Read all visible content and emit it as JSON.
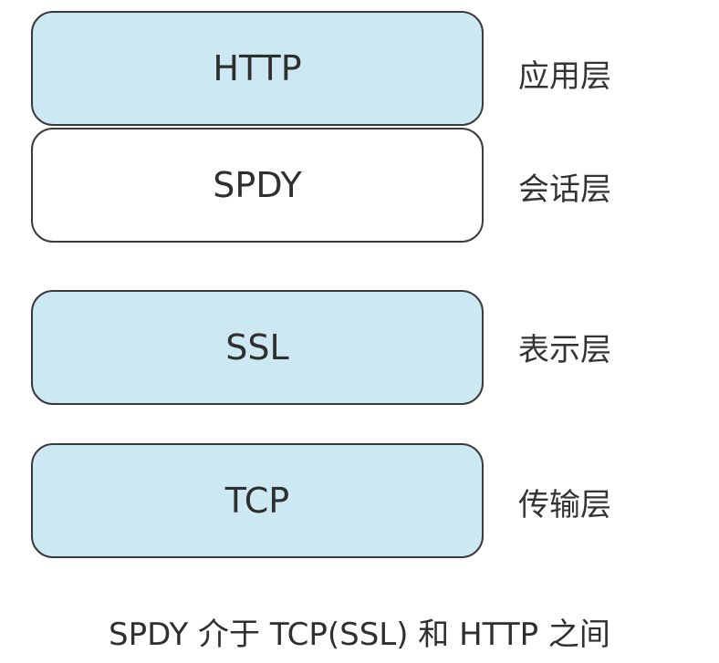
{
  "layers": [
    {
      "protocol": "HTTP",
      "layer": "应用层",
      "highlighted": true
    },
    {
      "protocol": "SPDY",
      "layer": "会话层",
      "highlighted": false
    },
    {
      "protocol": "SSL",
      "layer": "表示层",
      "highlighted": true
    },
    {
      "protocol": "TCP",
      "layer": "传输层",
      "highlighted": true
    }
  ],
  "caption": "SPDY 介于 TCP(SSL) 和 HTTP 之间",
  "colors": {
    "highlight_fill": "#cce9f3",
    "plain_fill": "#ffffff",
    "border": "#3a3a3a",
    "text": "#2f2f2f"
  }
}
